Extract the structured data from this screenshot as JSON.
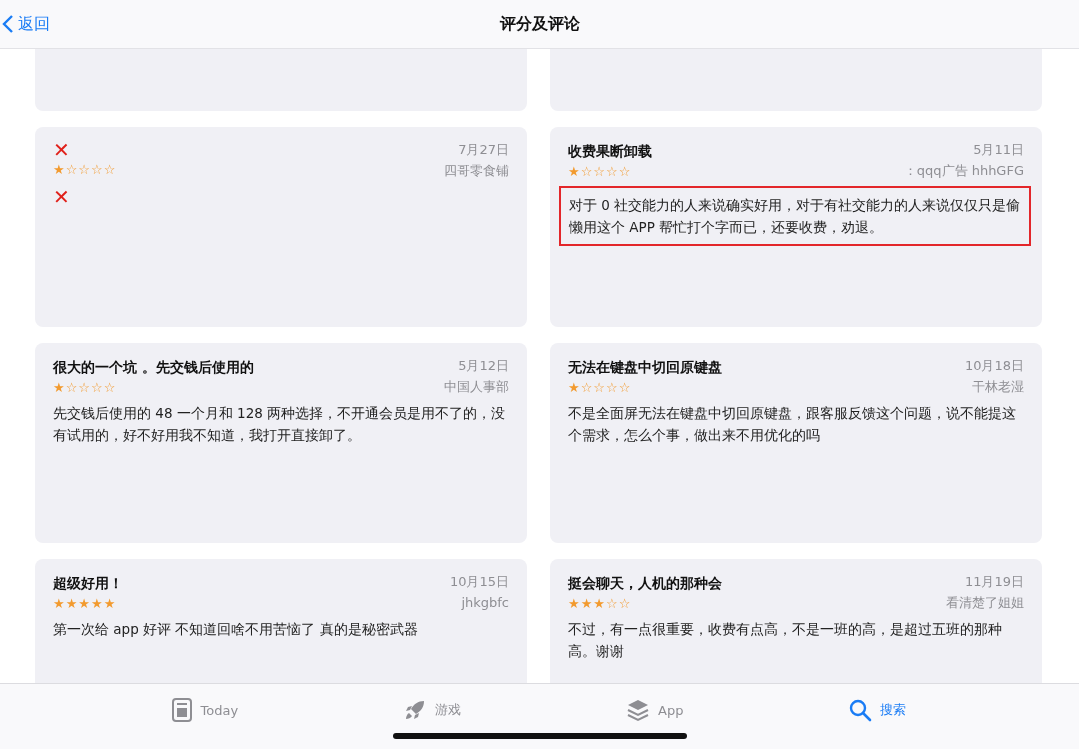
{
  "nav": {
    "back": "返回",
    "title": "评分及评论"
  },
  "reviews": [
    {
      "title": "✕",
      "stars": 1,
      "date": "7月27日",
      "author": "四哥零食铺",
      "body": "✕",
      "kind": "mark",
      "highlighted": false
    },
    {
      "title": "收费果断卸载",
      "stars": 1,
      "date": "5月11日",
      "author": "：qqq广告 hhhGFG",
      "body": "对于 0 社交能力的人来说确实好用，对于有社交能力的人来说仅仅只是偷懒用这个 APP 帮忙打个字而已，还要收费，劝退。",
      "kind": "text",
      "highlighted": true
    },
    {
      "title": "很大的一个坑 。先交钱后使用的",
      "stars": 1,
      "date": "5月12日",
      "author": "中国人事部",
      "body": "先交钱后使用的 48 一个月和 128 两种选择，不开通会员是用不了的，没有试用的，好不好用我不知道，我打开直接卸了。",
      "kind": "text",
      "highlighted": false
    },
    {
      "title": "无法在键盘中切回原键盘",
      "stars": 1,
      "date": "10月18日",
      "author": "干林老湿",
      "body": "不是全面屏无法在键盘中切回原键盘，跟客服反馈这个问题，说不能提这个需求，怎么个事，做出来不用优化的吗",
      "kind": "text",
      "highlighted": false
    },
    {
      "title": "超级好用！",
      "stars": 5,
      "date": "10月15日",
      "author": "jhkgbfc",
      "body": "第一次给 app 好评 不知道回啥不用苦恼了 真的是秘密武器",
      "kind": "text",
      "highlighted": false
    },
    {
      "title": "挺会聊天，人机的那种会",
      "stars": 3,
      "date": "11月19日",
      "author": "看清楚了姐姐",
      "body": "不过，有一点很重要，收费有点高，不是一班的高，是超过五班的那种高。谢谢",
      "kind": "text",
      "highlighted": false
    }
  ],
  "tabs": [
    {
      "label": "Today",
      "selected": false
    },
    {
      "label": "游戏",
      "selected": false
    },
    {
      "label": "App",
      "selected": false
    },
    {
      "label": "搜索",
      "selected": true
    }
  ]
}
